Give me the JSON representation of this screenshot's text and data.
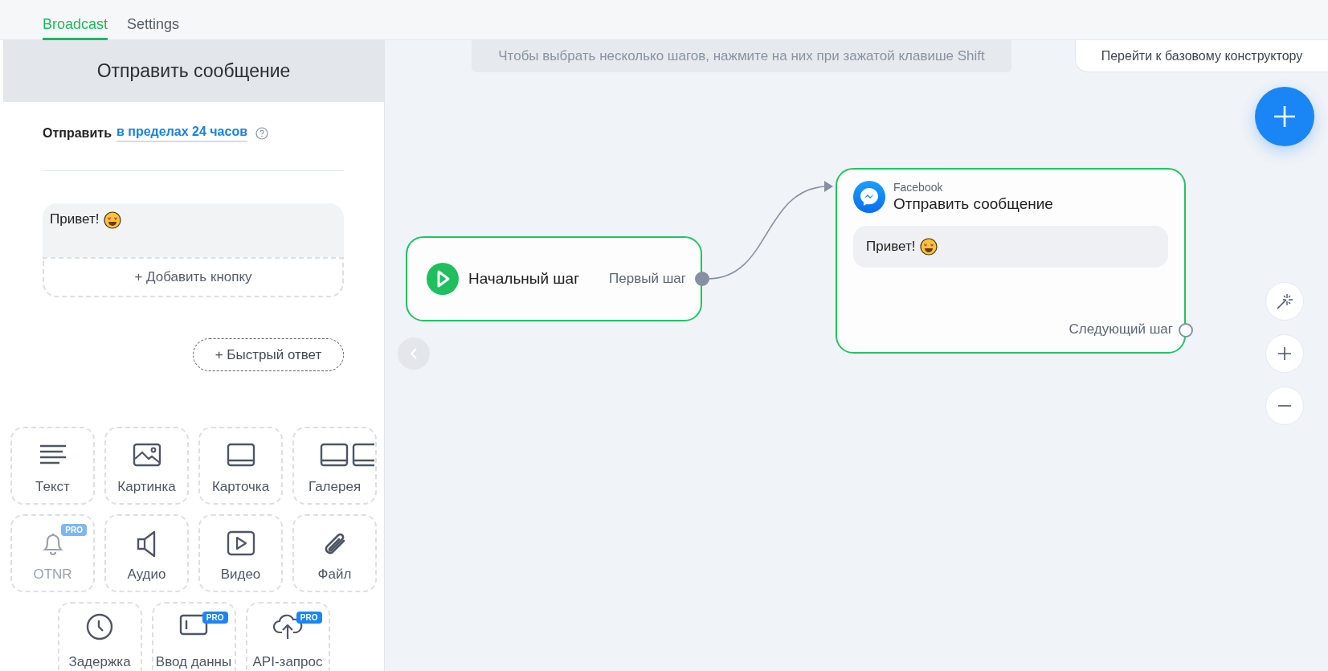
{
  "tabs": [
    {
      "label": "Broadcast",
      "selected": true
    },
    {
      "label": "Settings",
      "selected": false
    }
  ],
  "editor": {
    "title": "Отправить сообщение",
    "send_label": "Отправить",
    "send_window": "в пределах 24 часов",
    "message": {
      "text": "Привет!",
      "add_button": "+ Добавить кнопку"
    },
    "quick_reply": "+ Быстрый ответ",
    "blocks": [
      {
        "label": "Текст",
        "disabled": false
      },
      {
        "label": "Картинка",
        "disabled": false
      },
      {
        "label": "Карточка",
        "disabled": false
      },
      {
        "label": "Галерея",
        "disabled": false
      },
      {
        "label": "OTNR",
        "badge": "PRO",
        "disabled": true
      },
      {
        "label": "Аудио",
        "disabled": false
      },
      {
        "label": "Видео",
        "disabled": false
      },
      {
        "label": "Файл",
        "disabled": false
      },
      {
        "label": "Задержка",
        "disabled": false
      },
      {
        "label": "Ввод данны",
        "badge": "PRO",
        "disabled": false
      },
      {
        "label": "API-запрос",
        "badge": "PRO",
        "disabled": false
      }
    ]
  },
  "canvas": {
    "hint": "Чтобы выбрать несколько шагов, нажмите на них при зажатой клавише Shift",
    "basic_builder_button": "Перейти к базовому конструктору",
    "nodes": [
      {
        "kind": "start",
        "title": "Начальный шаг",
        "output": "Первый шаг",
        "connected": true
      },
      {
        "kind": "message",
        "channel": "Facebook",
        "title": "Отправить сообщение",
        "message": "Привет!",
        "output": "Следующий шаг",
        "connected": false
      }
    ]
  }
}
